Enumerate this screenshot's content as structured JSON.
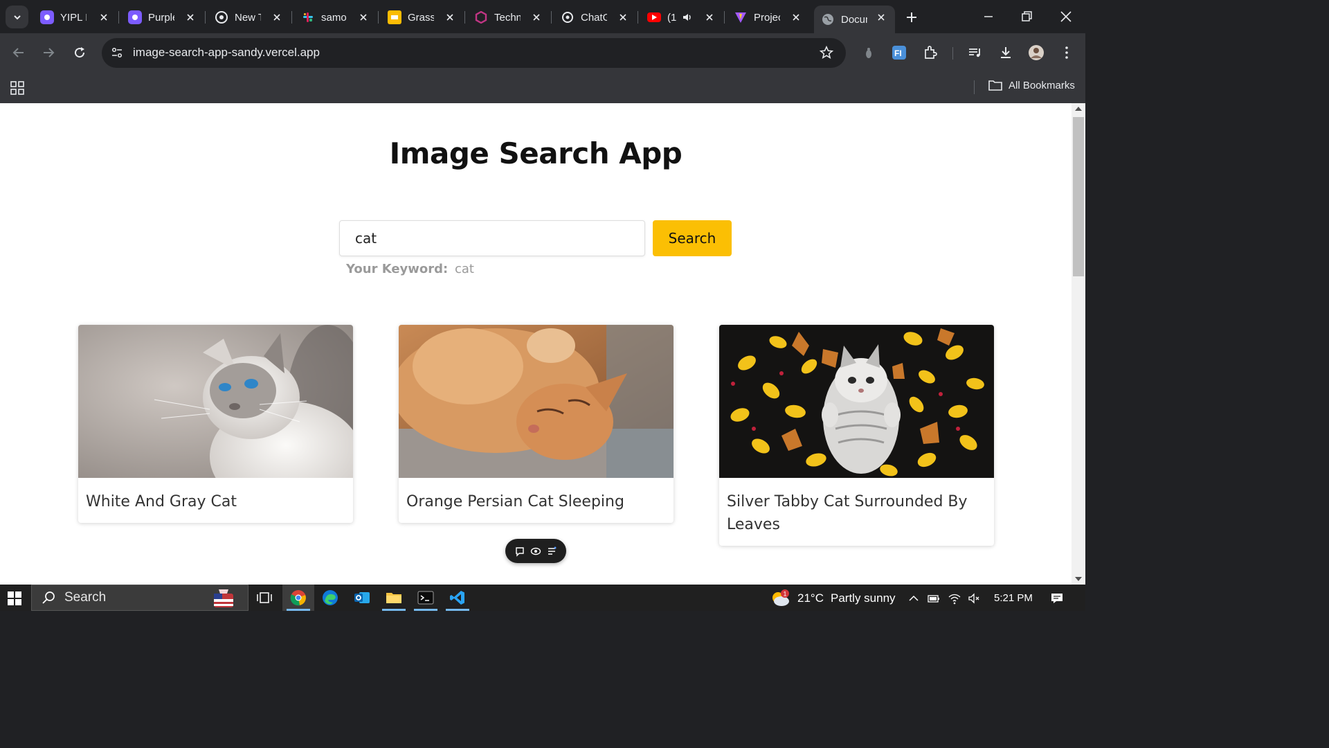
{
  "browser": {
    "tabs": [
      {
        "title": "YIPL Ir",
        "favicon": "app-icon",
        "color": "#7c5cff"
      },
      {
        "title": "Purple",
        "favicon": "app-icon",
        "color": "#7c5cff"
      },
      {
        "title": "New Tab",
        "favicon": "chrome-icon",
        "color": "#e8eaed"
      },
      {
        "title": "samo",
        "favicon": "slack-icon",
        "color": "#e01e5a"
      },
      {
        "title": "Grass",
        "favicon": "slides-icon",
        "color": "#fbbc04"
      },
      {
        "title": "Techn",
        "favicon": "app-icon",
        "color": "#c13584"
      },
      {
        "title": "ChatG",
        "favicon": "openai-icon",
        "color": "#e8eaed"
      },
      {
        "title": "(1",
        "favicon": "youtube-icon",
        "color": "#ff0000"
      },
      {
        "title": "Projec",
        "favicon": "vite-icon",
        "color": "#a259ff"
      },
      {
        "title": "Docum",
        "favicon": "globe-icon",
        "color": "#9aa0a6"
      }
    ],
    "url": "image-search-app-sandy.vercel.app",
    "bookmarks_label": "All Bookmarks"
  },
  "app": {
    "title": "Image Search App",
    "search_value": "cat",
    "search_button": "Search",
    "keyword_label": "Your Keyword:",
    "keyword_value": "cat",
    "results": [
      {
        "caption": "White And Gray Cat"
      },
      {
        "caption": "Orange Persian Cat Sleeping"
      },
      {
        "caption": "Silver Tabby Cat Surrounded By Leaves"
      }
    ]
  },
  "taskbar": {
    "search_label": "Search",
    "weather": "21°C",
    "weather_desc": "Partly sunny",
    "time": "5:21 PM",
    "weather_badge": "1"
  },
  "colors": {
    "accent": "#fbbf04",
    "chrome_dark": "#202124",
    "chrome_mid": "#35363a"
  }
}
